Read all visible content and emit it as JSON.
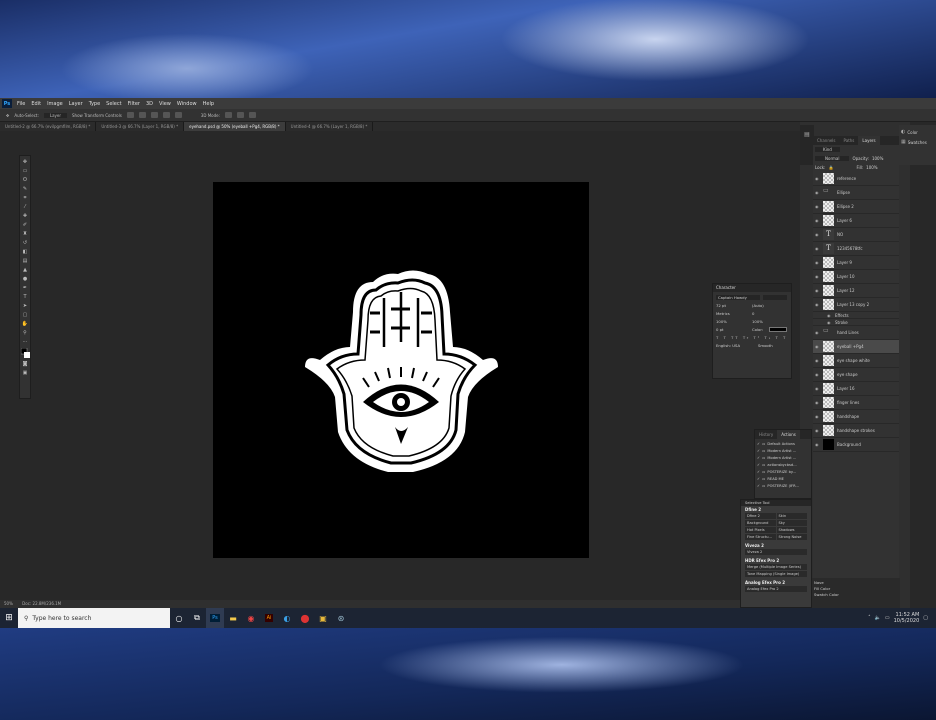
{
  "app": {
    "logo": "Ps"
  },
  "menu": [
    "File",
    "Edit",
    "Image",
    "Layer",
    "Type",
    "Select",
    "Filter",
    "3D",
    "View",
    "Window",
    "Help"
  ],
  "options_bar": {
    "auto_select": "Auto-Select:",
    "auto_select_value": "Layer",
    "transform": "Show Transform Controls",
    "mode": "3D Mode:"
  },
  "tabs": [
    {
      "label": "Untitled-2 @ 66.7% (evilpgmfilm, RGB/8) *",
      "active": false
    },
    {
      "label": "Untitled-3 @ 66.7% (Layer 1, RGB/8) *",
      "active": false
    },
    {
      "label": "eyehand.psd @ 50% (eyeball +Pg4, RGB/8) *",
      "active": true
    },
    {
      "label": "Untitled-4 @ 66.7% (Layer 1, RGB/8) *",
      "active": false
    }
  ],
  "status": {
    "zoom": "50%",
    "doc": "Doc: 22.8M/236.1M"
  },
  "layers_panel": {
    "tabs": [
      "Channels",
      "Paths",
      "Layers"
    ],
    "active_tab": "Layers",
    "kind": "Kind",
    "blend": "Normal",
    "opacity_label": "Opacity:",
    "opacity": "100%",
    "lock_label": "Lock:",
    "fill_label": "Fill:",
    "fill": "100%",
    "layers": [
      {
        "name": "reference",
        "thumb": "img"
      },
      {
        "name": "Ellipse",
        "thumb": "folder"
      },
      {
        "name": "Ellipse 2",
        "thumb": "img"
      },
      {
        "name": "Layer 6",
        "thumb": "img"
      },
      {
        "name": "NO",
        "thumb": "text"
      },
      {
        "name": "12345678tfc",
        "thumb": "text"
      },
      {
        "name": "Layer 9",
        "thumb": "img"
      },
      {
        "name": "Layer 10",
        "thumb": "img"
      },
      {
        "name": "Layer 12",
        "thumb": "img"
      },
      {
        "name": "Layer 13 copy 2",
        "thumb": "img"
      },
      {
        "name": "Effects",
        "thumb": "none"
      },
      {
        "name": "Stroke",
        "thumb": "none"
      },
      {
        "name": "hand Lines",
        "thumb": "folder"
      },
      {
        "name": "eyeball +Pg4",
        "thumb": "img",
        "selected": true
      },
      {
        "name": "eye shape white",
        "thumb": "img"
      },
      {
        "name": "eye shape",
        "thumb": "img"
      },
      {
        "name": "Layer 16",
        "thumb": "img"
      },
      {
        "name": "finger lines",
        "thumb": "img"
      },
      {
        "name": "handshape",
        "thumb": "img"
      },
      {
        "name": "handshape strokes",
        "thumb": "img"
      },
      {
        "name": "Background",
        "thumb": "black"
      }
    ]
  },
  "right_panel": {
    "color": "Color",
    "swatches": "Swatches"
  },
  "character": {
    "title": "Character",
    "font": "Captain Howdy",
    "style": "",
    "size": "72 pt",
    "leading": "(Auto)",
    "tracking": "Metrics",
    "kerning": "0",
    "vscale": "100%",
    "hscale": "100%",
    "baseline": "0 pt",
    "color_label": "Color:",
    "lang": "English: USA",
    "aa": "Smooth"
  },
  "actions_panel": {
    "tabs": [
      "History",
      "Actions"
    ],
    "items": [
      "Default Actions",
      "Modern Artist ...",
      "Modern Artist ...",
      "actionsbycbsd...",
      "POSTERIZE by...",
      "READ ME",
      "POSTERIZE (IFR..."
    ]
  },
  "selective_tool": {
    "title": "Selective Tool",
    "sections": [
      {
        "name": "Dfine 2",
        "buttons": [
          "Dfine 2",
          "Skin",
          "Background",
          "Sky",
          "Hot Pixels",
          "Shadows",
          "Fine Structu...",
          "Strong Noise"
        ]
      },
      {
        "name": "Viveza 2",
        "buttons": [
          "Viveza 2"
        ]
      },
      {
        "name": "HDR Efex Pro 2",
        "buttons": [
          "Merge (Multiple Image Series)",
          "Tone Mapping (Single Image)"
        ]
      },
      {
        "name": "Analog Efex Pro 2",
        "buttons": [
          "Analog Efex Pro 2"
        ]
      }
    ]
  },
  "panel_bottom": {
    "item1": "Nave",
    "item2": "Fill Color",
    "item3": "Swatch Color"
  },
  "taskbar": {
    "search_placeholder": "Type here to search",
    "time": "11:52 AM",
    "date": "10/5/2020",
    "icons": [
      "cortana-icon",
      "task-view-icon",
      "photoshop-icon",
      "file-explorer-icon",
      "chrome-icon",
      "illustrator-icon",
      "edge-icon",
      "app-red-icon",
      "app-yellow-icon",
      "steam-icon"
    ]
  }
}
